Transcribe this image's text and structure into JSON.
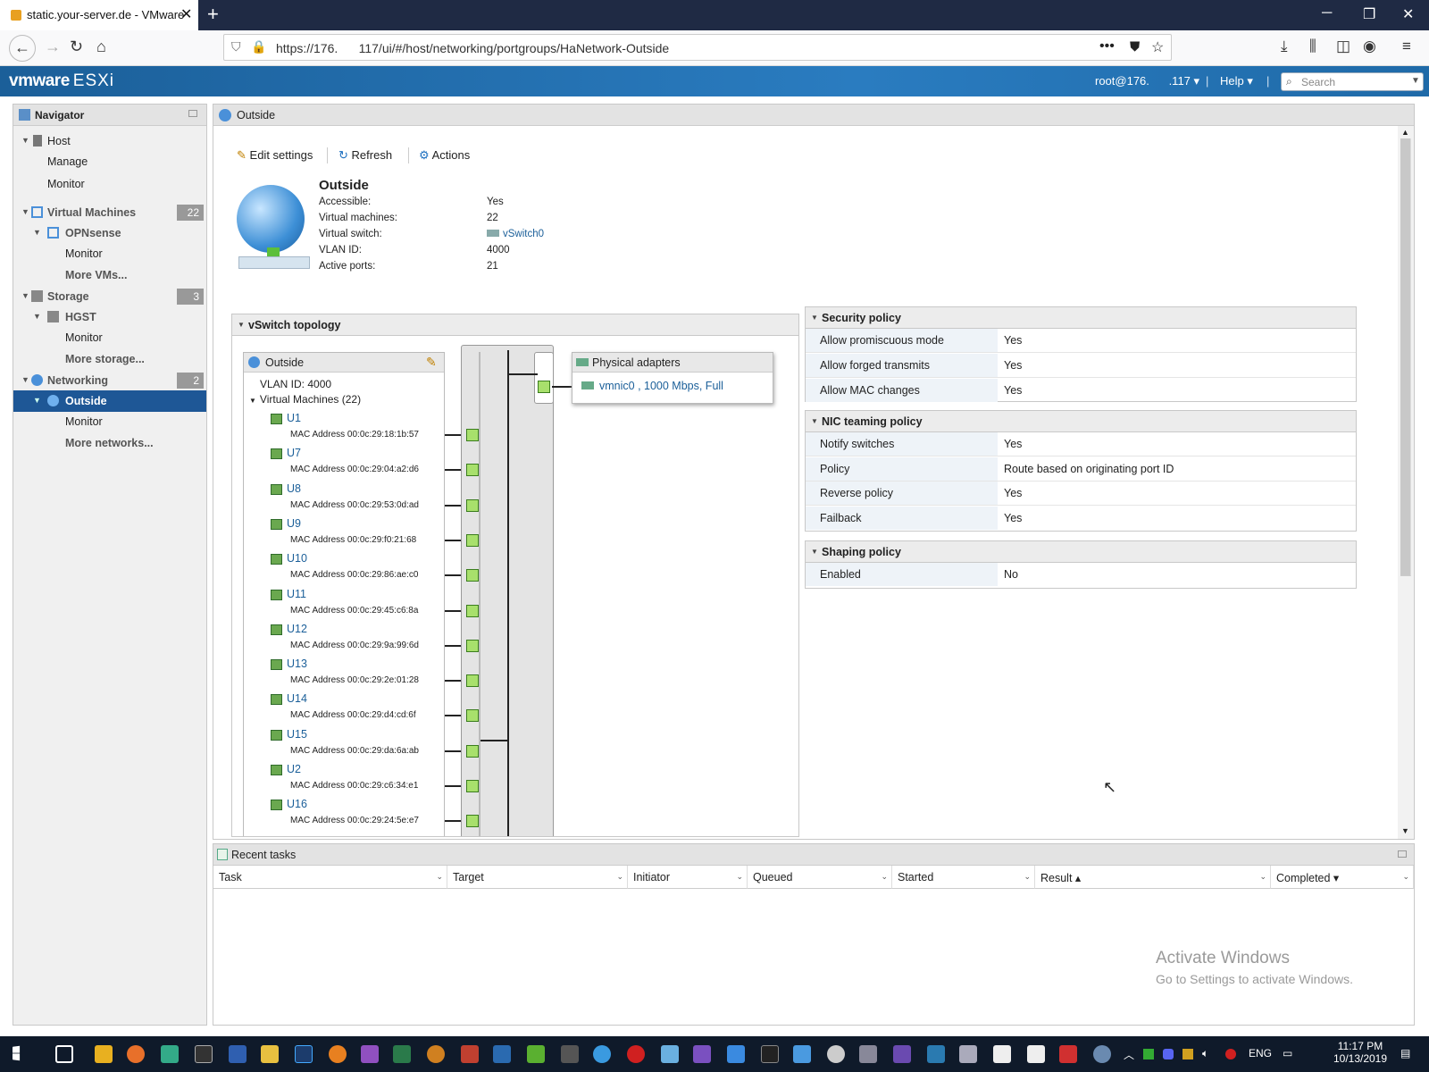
{
  "browser": {
    "tab_title": "static.your-server.de - VMware",
    "url": "https://176.      117/ui/#/host/networking/portgroups/HaNetwork-Outside"
  },
  "header": {
    "logo_main": "vmware",
    "logo_product": "ESXi",
    "user": "root@176.      .117 ▾",
    "help": "Help ▾",
    "search_placeholder": "Search"
  },
  "navigator": {
    "title": "Navigator",
    "items": [
      {
        "label": "Host"
      },
      {
        "label": "Manage"
      },
      {
        "label": "Monitor"
      },
      {
        "label": "Virtual Machines",
        "count": "22"
      },
      {
        "label": "OPNsense"
      },
      {
        "label": "Monitor"
      },
      {
        "label": "More VMs..."
      },
      {
        "label": "Storage",
        "count": "3"
      },
      {
        "label": "HGST"
      },
      {
        "label": "Monitor"
      },
      {
        "label": "More storage..."
      },
      {
        "label": "Networking",
        "count": "2"
      },
      {
        "label": "Outside"
      },
      {
        "label": "Monitor"
      },
      {
        "label": "More networks..."
      }
    ]
  },
  "main": {
    "title": "Outside",
    "toolbar": {
      "edit": "Edit settings",
      "refresh": "Refresh",
      "actions": "Actions"
    },
    "portgroup": {
      "name": "Outside",
      "props": [
        {
          "k": "Accessible:",
          "v": "Yes"
        },
        {
          "k": "Virtual machines:",
          "v": "22"
        },
        {
          "k": "Virtual switch:",
          "v": "vSwitch0"
        },
        {
          "k": "VLAN ID:",
          "v": "4000"
        },
        {
          "k": "Active ports:",
          "v": "21"
        }
      ]
    },
    "topology": {
      "title": "vSwitch topology",
      "pg_name": "Outside",
      "vlan": "VLAN ID: 4000",
      "vm_group": "Virtual Machines (22)",
      "vms": [
        {
          "name": "U1",
          "mac": "MAC Address 00:0c:29:18:1b:57"
        },
        {
          "name": "U7",
          "mac": "MAC Address 00:0c:29:04:a2:d6"
        },
        {
          "name": "U8",
          "mac": "MAC Address 00:0c:29:53:0d:ad"
        },
        {
          "name": "U9",
          "mac": "MAC Address 00:0c:29:f0:21:68"
        },
        {
          "name": "U10",
          "mac": "MAC Address 00:0c:29:86:ae:c0"
        },
        {
          "name": "U11",
          "mac": "MAC Address 00:0c:29:45:c6:8a"
        },
        {
          "name": "U12",
          "mac": "MAC Address 00:0c:29:9a:99:6d"
        },
        {
          "name": "U13",
          "mac": "MAC Address 00:0c:29:2e:01:28"
        },
        {
          "name": "U14",
          "mac": "MAC Address 00:0c:29:d4:cd:6f"
        },
        {
          "name": "U15",
          "mac": "MAC Address 00:0c:29:da:6a:ab"
        },
        {
          "name": "U2",
          "mac": "MAC Address 00:0c:29:c6:34:e1"
        },
        {
          "name": "U16",
          "mac": "MAC Address 00:0c:29:24:5e:e7"
        }
      ],
      "physical_title": "Physical adapters",
      "physical_nic": "vmnic0 , 1000 Mbps, Full"
    },
    "security": {
      "title": "Security policy",
      "rows": [
        {
          "k": "Allow promiscuous mode",
          "v": "Yes"
        },
        {
          "k": "Allow forged transmits",
          "v": "Yes"
        },
        {
          "k": "Allow MAC changes",
          "v": "Yes"
        }
      ]
    },
    "nic": {
      "title": "NIC teaming policy",
      "rows": [
        {
          "k": "Notify switches",
          "v": "Yes"
        },
        {
          "k": "Policy",
          "v": "Route based on originating port ID"
        },
        {
          "k": "Reverse policy",
          "v": "Yes"
        },
        {
          "k": "Failback",
          "v": "Yes"
        }
      ]
    },
    "shaping": {
      "title": "Shaping policy",
      "rows": [
        {
          "k": "Enabled",
          "v": "No"
        }
      ]
    }
  },
  "tasks": {
    "title": "Recent tasks",
    "columns": [
      "Task",
      "Target",
      "Initiator",
      "Queued",
      "Started",
      "Result ▴",
      "Completed ▾"
    ]
  },
  "watermark": {
    "line1": "Activate Windows",
    "line2": "Go to Settings to activate Windows."
  },
  "taskbar": {
    "lang": "ENG",
    "time": "11:17 PM",
    "date": "10/13/2019"
  }
}
